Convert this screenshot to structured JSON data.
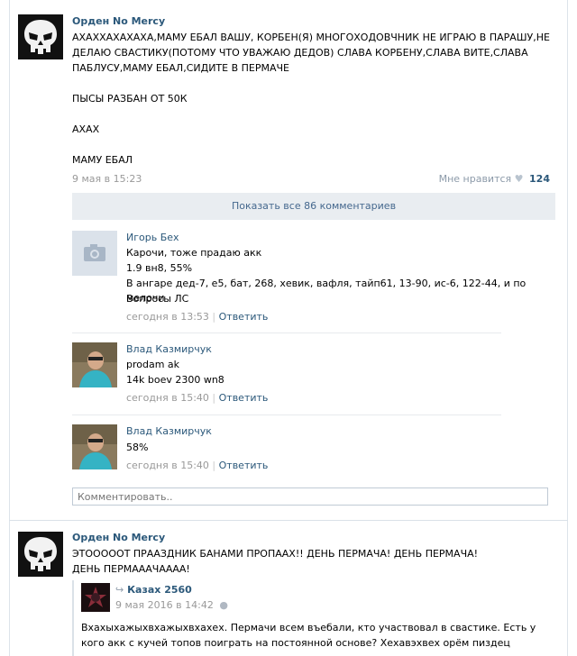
{
  "post1": {
    "author": "Орден No Mercy",
    "text": "АХАХХАХАХАХА,МАМУ ЕБАЛ ВАШУ, КОРБЕН(Я) МНОГОХОДОВЧНИК НЕ ИГРАЮ В ПАРАШУ,НЕ ДЕЛАЮ СВАСТИКУ(ПОТОМУ ЧТО УВАЖАЮ ДЕДОВ) СЛАВА КОРБЕНУ,СЛАВА ВИТЕ,СЛАВА ПАБЛУСУ,МАМУ ЕБАЛ,СИДИТЕ В ПЕРМАЧЕ\n\nПЫСЫ РАЗБАН ОТ 50К\n\nАХАХ\n\nМАМУ ЕБАЛ",
    "date": "9 мая в 15:23",
    "like_label": "Мне нравится",
    "like_icon": "heart-icon",
    "like_count": "124",
    "show_all_label": "Показать все 86 комментариев",
    "comments": [
      {
        "name": "Игорь Бех",
        "lines": [
          "Карочи, тоже прадаю акк",
          "1.9 вн8, 55%",
          "В ангаре дед-7, е5, бат, 268, хевик, вафля, тайп61, 13-90, ис-6, 122-44, и по мелочи",
          "Вопросы ЛС"
        ],
        "date": "сегодня в 13:53",
        "reply": "Ответить",
        "avatar": "camera-icon"
      },
      {
        "name": "Влад Казмирчук",
        "lines": [
          "prodam ak",
          "14k boev 2300 wn8"
        ],
        "date": "сегодня в 15:40",
        "reply": "Ответить",
        "avatar": "user-photo"
      },
      {
        "name": "Влад Казмирчук",
        "lines": [
          "58%"
        ],
        "date": "сегодня в 15:40",
        "reply": "Ответить",
        "avatar": "user-photo"
      }
    ],
    "comment_placeholder": "Комментировать.."
  },
  "post2": {
    "author": "Орден No Mercy",
    "text": "ЭТОООООТ ПРААЗДНИК БАНАМИ ПРОПААХ!! ДЕНЬ ПЕРМАЧА! ДЕНЬ ПЕРМАЧА! ДЕНЬ ПЕРМАААЧАААА!",
    "repost": {
      "name": "Казах 2560",
      "date": "9 мая 2016 в 14:42",
      "text": "Вхахыхажыхвхажыхвхахех. Пермачи всем въебали, кто участвовал в свастике. Есть у кого акк с кучей топов поиграть на постоянной основе? Хехавэхвех орём пиздец вхахехвхв"
    }
  },
  "colors": {
    "link": "#2b587a",
    "meta": "#999999",
    "show_all_bg": "#e9edf1"
  }
}
